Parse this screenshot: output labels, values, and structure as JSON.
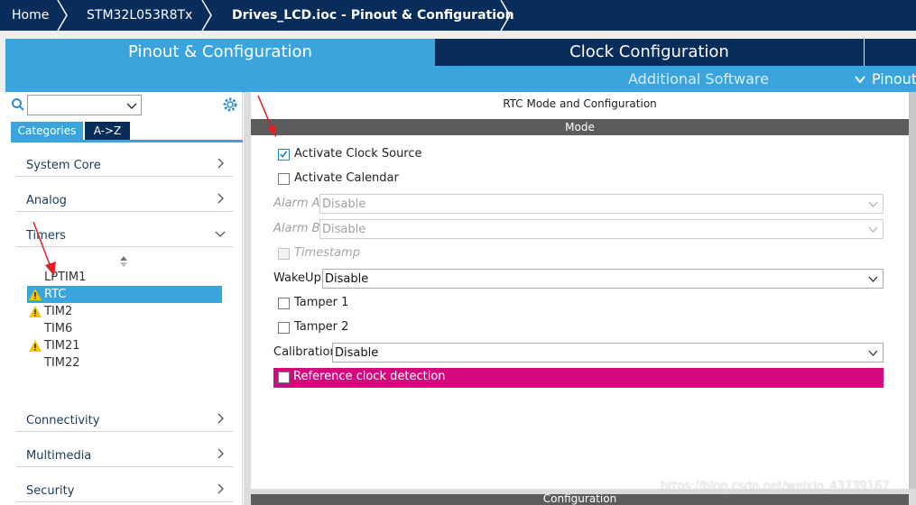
{
  "colors": {
    "navy": "#082d5a",
    "accent_blue": "#3aa5dc",
    "section_gray": "#5c5c5c",
    "warning": "#f5c400",
    "highlight": "#d4097d",
    "arrow_red": "#e02020"
  },
  "breadcrumb": {
    "items": [
      "Home",
      "STM32L053R8Tx",
      "Drives_LCD.ioc - Pinout & Configuration"
    ]
  },
  "tabs": {
    "main": "Pinout & Configuration",
    "clock": "Clock Configuration",
    "additional_software": "Additional Software",
    "pinout": "Pinout"
  },
  "sidebar": {
    "search_value": "",
    "view_tabs": [
      "Categories",
      "A->Z"
    ],
    "categories": [
      {
        "label": "System Core",
        "expanded": false
      },
      {
        "label": "Analog",
        "expanded": false
      },
      {
        "label": "Timers",
        "expanded": true
      },
      {
        "label": "Connectivity",
        "expanded": false
      },
      {
        "label": "Multimedia",
        "expanded": false
      },
      {
        "label": "Security",
        "expanded": false
      }
    ],
    "timers": [
      {
        "label": "LPTIM1",
        "warning": false,
        "selected": false
      },
      {
        "label": "RTC",
        "warning": true,
        "selected": true
      },
      {
        "label": "TIM2",
        "warning": true,
        "selected": false
      },
      {
        "label": "TIM6",
        "warning": false,
        "selected": false
      },
      {
        "label": "TIM21",
        "warning": true,
        "selected": false
      },
      {
        "label": "TIM22",
        "warning": false,
        "selected": false
      }
    ]
  },
  "panel": {
    "title": "RTC Mode and Configuration",
    "section": "Mode",
    "footer": "Configuration",
    "activate_clock_source": {
      "label": "Activate Clock Source",
      "checked": true
    },
    "activate_calendar": {
      "label": "Activate Calendar",
      "checked": false
    },
    "alarm_a": {
      "label": "Alarm A",
      "value": "Disable"
    },
    "alarm_b": {
      "label": "Alarm B",
      "value": "Disable"
    },
    "timestamp": {
      "label": "Timestamp",
      "checked": false
    },
    "wakeup": {
      "label": "WakeUp",
      "value": "Disable"
    },
    "tamper1": {
      "label": "Tamper 1",
      "checked": false
    },
    "tamper2": {
      "label": "Tamper 2",
      "checked": false
    },
    "calibration": {
      "label": "Calibration",
      "value": "Disable"
    },
    "reference_clock": {
      "label": "Reference clock detection",
      "checked": false
    }
  },
  "watermark": "https://blog.csdn.net/weixin_43739167"
}
